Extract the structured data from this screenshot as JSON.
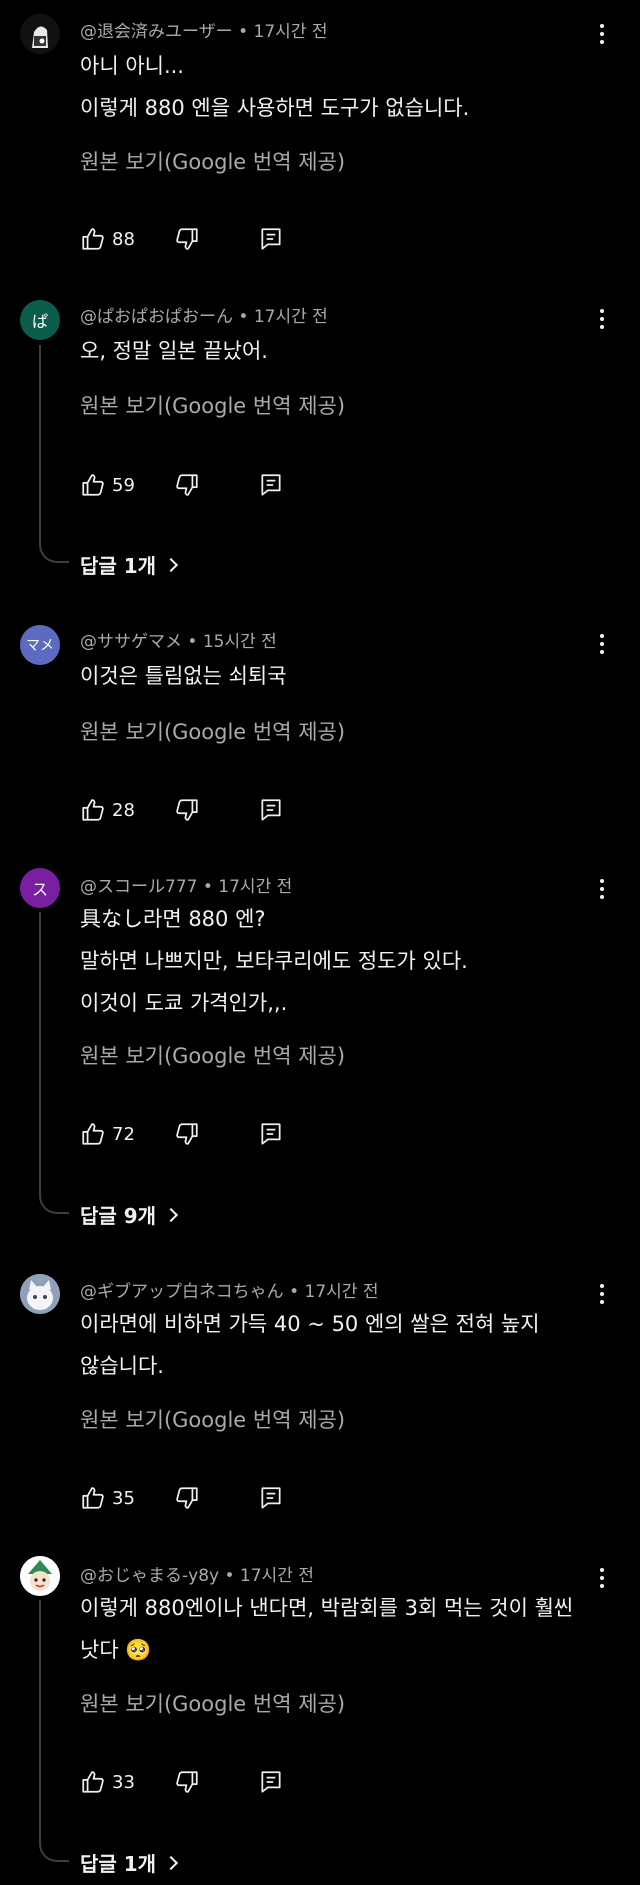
{
  "comments": [
    {
      "author": "@退会済みユーザー",
      "time": "17시간 전",
      "avatar_text": "",
      "avatar_color": "#1a1a1a",
      "avatar_icon": "anime-character-avatar",
      "body": "아니 아니...\n이렇게 880 엔을 사용하면 도구가 없습니다.",
      "translate_label": "원본 보기(Google 번역 제공)",
      "likes": "88",
      "replies_label": ""
    },
    {
      "author": "@ぱおぱおぱおーん",
      "time": "17시간 전",
      "avatar_text": "ぱ",
      "avatar_color": "#0b5d4b",
      "avatar_icon": "",
      "body": "오, 정말 일본 끝났어.",
      "translate_label": "원본 보기(Google 번역 제공)",
      "likes": "59",
      "replies_label": "답글 1개"
    },
    {
      "author": "@ササゲマメ",
      "time": "15시간 전",
      "avatar_text": "マメ",
      "avatar_color": "#5c6bc0",
      "avatar_icon": "",
      "body": "이것은 틀림없는 쇠퇴국",
      "translate_label": "원본 보기(Google 번역 제공)",
      "likes": "28",
      "replies_label": ""
    },
    {
      "author": "@スコール777",
      "time": "17시간 전",
      "avatar_text": "ス",
      "avatar_color": "#7b1fa2",
      "avatar_icon": "",
      "body": "具なし라면 880 엔?\n말하면 나쁘지만, 보타쿠리에도 정도가 있다.\n이것이 도쿄 가격인가,,.",
      "translate_label": "원본 보기(Google 번역 제공)",
      "likes": "72",
      "replies_label": "답글 9개"
    },
    {
      "author": "@ギブアップ白ネコちゃん",
      "time": "17시간 전",
      "avatar_text": "",
      "avatar_color": "#b7c4d8",
      "avatar_icon": "white-cat-avatar",
      "body": "이라면에 비하면 가득 40 ~ 50 엔의 쌀은 전혀 높지\n않습니다.",
      "translate_label": "원본 보기(Google 번역 제공)",
      "likes": "35",
      "replies_label": ""
    },
    {
      "author": "@おじゃまる-y8y",
      "time": "17시간 전",
      "avatar_text": "",
      "avatar_color": "#ffffff",
      "avatar_icon": "cartoon-character-avatar",
      "body": "이렇게 880엔이나 낸다면, 박람회를 3회 먹는 것이 훨씬\n낫다 🥺",
      "translate_label": "원본 보기(Google 번역 제공)",
      "likes": "33",
      "replies_label": "답글 1개"
    }
  ],
  "separator": "•"
}
